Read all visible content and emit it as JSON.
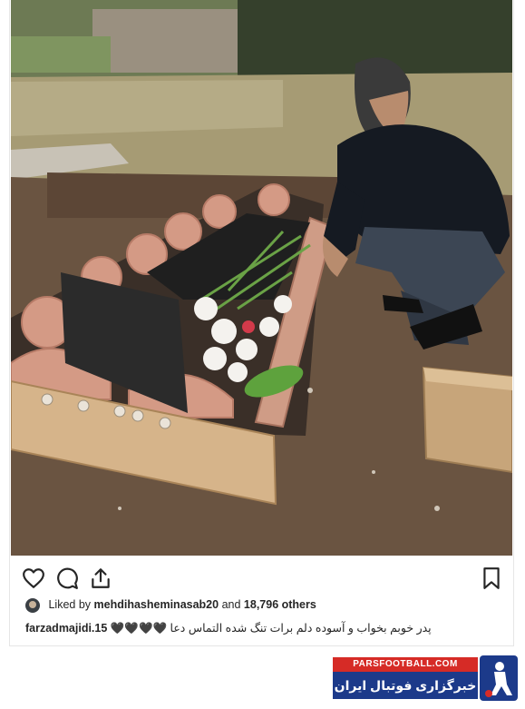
{
  "post": {
    "photo_alt": "",
    "likes": {
      "prefix": "Liked by",
      "user": "mehdihasheminasab20",
      "joiner": "and",
      "others": "18,796 others"
    },
    "caption": {
      "user": "farzadmajidi.15",
      "text": "پدر خوبم بخواب و آسوده دلم برات تنگ شده التماس دعا 🖤🖤🖤🖤"
    }
  },
  "actions": {
    "like_icon": "heart-icon",
    "comment_icon": "comment-icon",
    "share_icon": "share-icon",
    "save_icon": "bookmark-icon"
  },
  "watermark": {
    "top": "PARSFOOTBALL.COM",
    "bottom": "خبرگزاری فوتبال ایران"
  },
  "colors": {
    "brand_red": "#d62b26",
    "brand_blue": "#1c3a8a"
  }
}
